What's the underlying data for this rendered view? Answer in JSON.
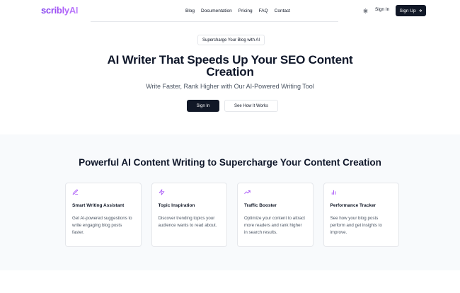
{
  "header": {
    "logo_text": "scriblyAI",
    "nav": [
      "Blog",
      "Documentation",
      "Pricing",
      "FAQ",
      "Contact"
    ],
    "theme_icon": "sun-icon",
    "signin_label": "Sign In",
    "signup_label": "Sign Up",
    "signup_icon": "arrow-right-icon"
  },
  "hero": {
    "badge": "Supercharge Your Blog with AI",
    "title": "AI Writer That Speeds Up Your SEO Content Creation",
    "subtitle": "Write Faster, Rank Higher with Our AI-Powered Writing Tool",
    "primary_button": "Sign In",
    "secondary_button": "See How It Works"
  },
  "features": {
    "title": "Powerful AI Content Writing to Supercharge Your Content Creation",
    "cards": [
      {
        "icon": "pencil-icon",
        "title": "Smart Writing Assistant",
        "desc": "Get AI-powered suggestions to write engaging blog posts faster."
      },
      {
        "icon": "zap-icon",
        "title": "Topic Inspiration",
        "desc": "Discover trending topics your audience wants to read about."
      },
      {
        "icon": "trending-up-icon",
        "title": "Traffic Booster",
        "desc": "Optimize your content to attract more readers and rank higher in search results."
      },
      {
        "icon": "bar-chart-icon",
        "title": "Performance Tracker",
        "desc": "See how your blog posts perform and get insights to improve."
      }
    ]
  },
  "colors": {
    "accent": "#a855f7",
    "dark": "#111827",
    "section_bg": "#f8fafc"
  }
}
